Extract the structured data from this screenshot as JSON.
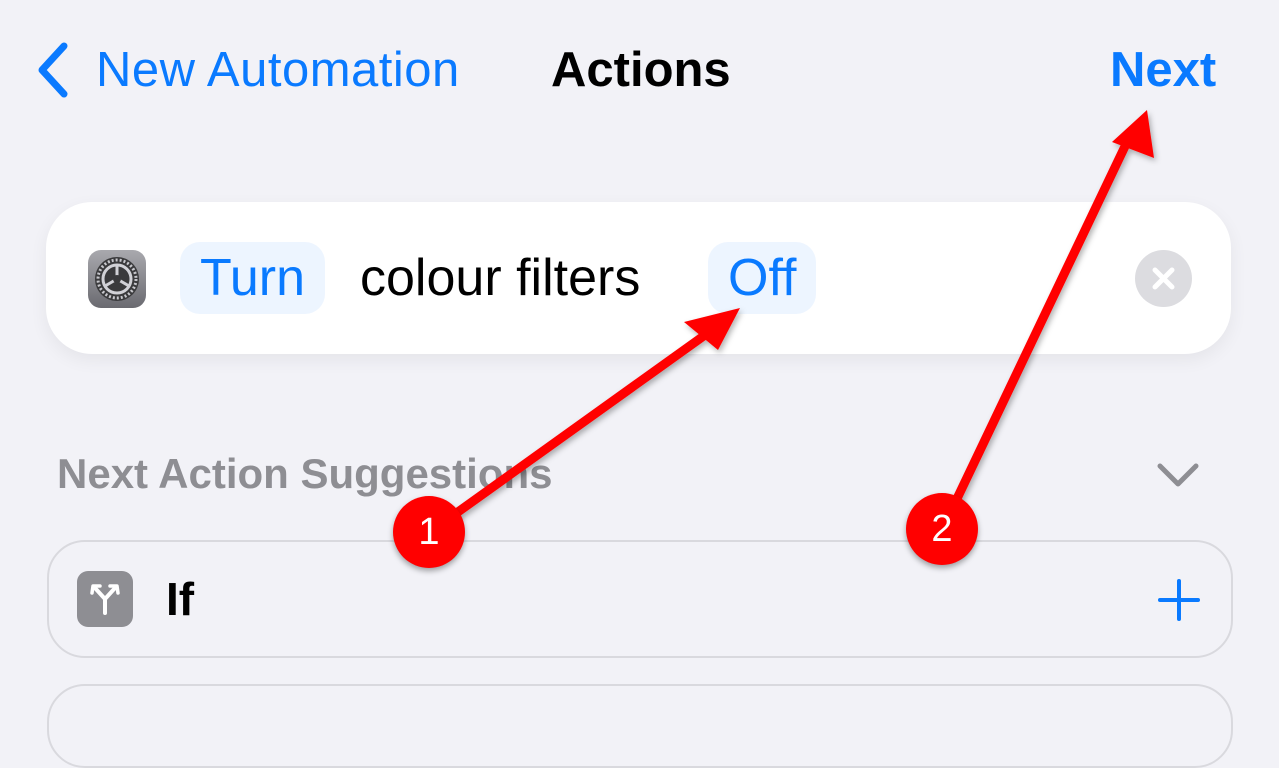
{
  "nav": {
    "back_label": "New Automation",
    "title": "Actions",
    "next_label": "Next"
  },
  "action": {
    "icon": "settings-gear-icon",
    "verb_param": "Turn",
    "text": "colour filters",
    "state_param": "Off",
    "remove_icon": "close-circle-icon"
  },
  "suggestions": {
    "header": "Next Action Suggestions",
    "collapse_icon": "chevron-down-icon",
    "items": [
      {
        "label": "If",
        "icon": "branch-icon",
        "action_icon": "plus-icon"
      }
    ]
  },
  "annotations": {
    "color": "#ff0000",
    "badges": [
      "1",
      "2"
    ]
  },
  "colors": {
    "accent": "#0a7aff",
    "background": "#f2f2f7",
    "secondary_text": "#8e8e93"
  }
}
